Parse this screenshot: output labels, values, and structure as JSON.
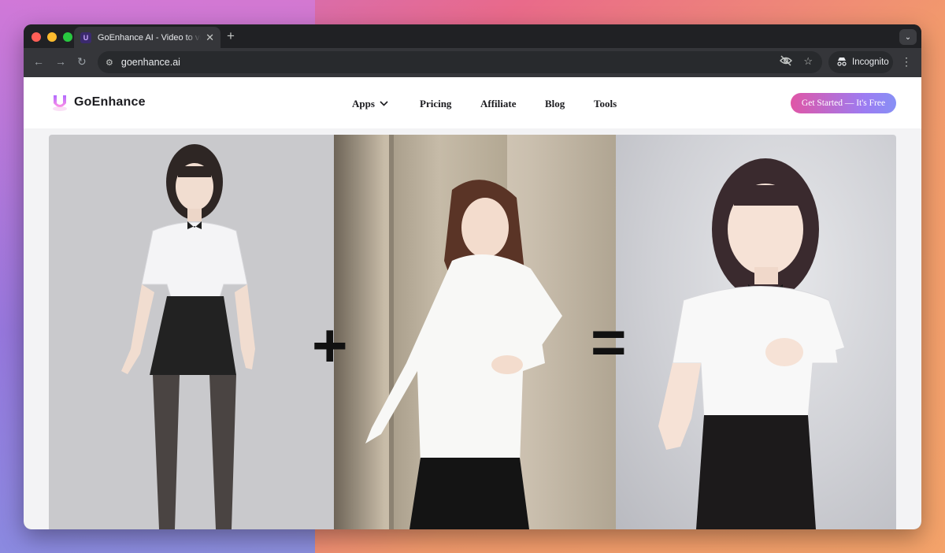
{
  "browser": {
    "tab_title": "GoEnhance AI - Video to video",
    "tab_close": "✕",
    "new_tab": "+",
    "url": "goenhance.ai",
    "incognito_label": "Incognito"
  },
  "site": {
    "brand": "GoEnhance",
    "nav": [
      {
        "label": "Apps",
        "has_dropdown": true
      },
      {
        "label": "Pricing"
      },
      {
        "label": "Affiliate"
      },
      {
        "label": "Blog"
      },
      {
        "label": "Tools"
      }
    ],
    "cta_label": "Get Started — It's Free"
  },
  "hero": {
    "plus_sign": "+",
    "equals_sign": "="
  },
  "colors": {
    "cta_start": "#e056a6",
    "cta_end": "#8790f5",
    "logo_purple": "#9b3cf0"
  }
}
